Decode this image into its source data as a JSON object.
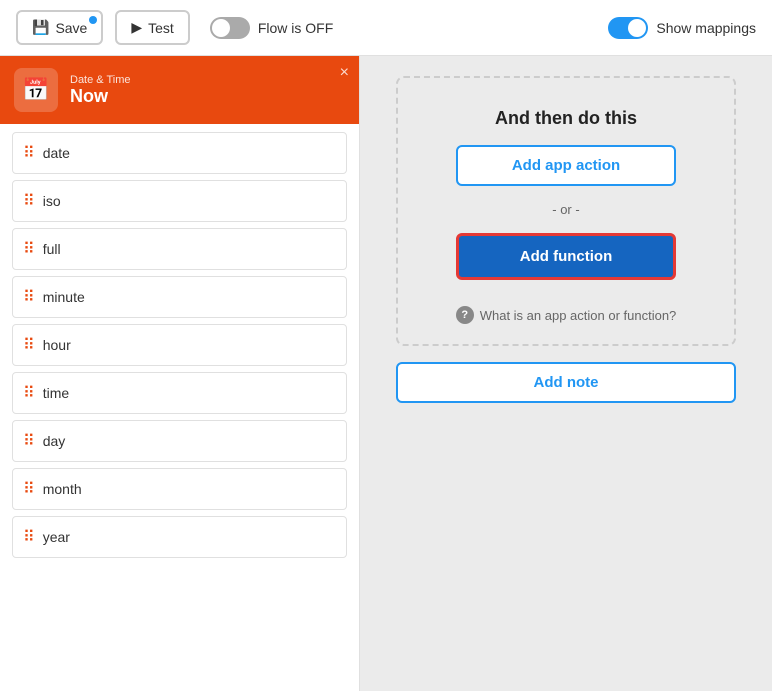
{
  "toolbar": {
    "save_label": "Save",
    "test_label": "Test",
    "flow_status": "Flow is OFF",
    "show_mappings_label": "Show mappings",
    "flow_is_on": false,
    "mappings_is_on": true
  },
  "left_panel": {
    "header": {
      "subtitle": "Date & Time",
      "title": "Now",
      "close_label": "×"
    },
    "items": [
      {
        "label": "date"
      },
      {
        "label": "iso"
      },
      {
        "label": "full"
      },
      {
        "label": "minute"
      },
      {
        "label": "hour"
      },
      {
        "label": "time"
      },
      {
        "label": "day"
      },
      {
        "label": "month"
      },
      {
        "label": "year"
      }
    ]
  },
  "right_panel": {
    "card_title": "And then do this",
    "add_app_action_label": "Add app action",
    "or_label": "- or -",
    "add_function_label": "Add function",
    "help_text": "What is an app action or function?",
    "add_note_label": "Add note"
  },
  "icons": {
    "save": "💾",
    "play": "▶",
    "calendar": "📅",
    "question": "?"
  }
}
